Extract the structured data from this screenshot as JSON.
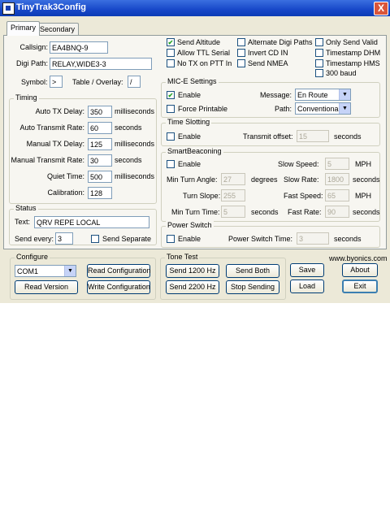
{
  "window": {
    "title": "TinyTrak3Config",
    "close": "X"
  },
  "tabs": [
    {
      "label": "Primary"
    },
    {
      "label": "Secondary"
    }
  ],
  "identity": {
    "callsign_label": "Callsign:",
    "callsign": "EA4BNQ-9",
    "digipath_label": "Digi Path:",
    "digipath": "RELAY,WIDE3-3",
    "symbol_label": "Symbol:",
    "symbol": ">",
    "table_label": "Table / Overlay:",
    "table": "/"
  },
  "options": {
    "send_altitude": "Send Altitude",
    "alt_digi": "Alternate Digi Paths",
    "only_valid": "Only Send Valid",
    "allow_ttl": "Allow TTL Serial",
    "invert_cd": "Invert CD IN",
    "ts_dhm": "Timestamp DHM",
    "no_tx_ptt": "No TX on PTT In",
    "send_nmea": "Send NMEA",
    "ts_hms": "Timestamp HMS",
    "baud300": "300 baud"
  },
  "timing": {
    "title": "Timing",
    "auto_tx_delay_label": "Auto TX Delay:",
    "auto_tx_delay": "350",
    "auto_tx_delay_unit": "milliseconds",
    "auto_rate_label": "Auto Transmit Rate:",
    "auto_rate": "60",
    "auto_rate_unit": "seconds",
    "man_tx_delay_label": "Manual TX Delay:",
    "man_tx_delay": "125",
    "man_tx_delay_unit": "milliseconds",
    "man_rate_label": "Manual Transmit Rate:",
    "man_rate": "30",
    "man_rate_unit": "seconds",
    "quiet_label": "Quiet Time:",
    "quiet": "500",
    "quiet_unit": "milliseconds",
    "cal_label": "Calibration:",
    "cal": "128"
  },
  "status": {
    "title": "Status",
    "text_label": "Text:",
    "text": "QRV REPE LOCAL",
    "every_label": "Send every:",
    "every": "3",
    "separate": "Send Separate"
  },
  "mice": {
    "title": "MIC-E Settings",
    "enable": "Enable",
    "message_label": "Message:",
    "message": "En Route",
    "force": "Force Printable",
    "path_label": "Path:",
    "path": "Conventional"
  },
  "timeslot": {
    "title": "Time Slotting",
    "enable": "Enable",
    "offset_label": "Transmit offset:",
    "offset": "15",
    "unit": "seconds"
  },
  "smart": {
    "title": "SmartBeaconing",
    "enable": "Enable",
    "slow_speed_label": "Slow Speed:",
    "slow_speed": "5",
    "slow_speed_unit": "MPH",
    "min_angle_label": "Min Turn Angle:",
    "min_angle": "27",
    "min_angle_unit": "degrees",
    "slow_rate_label": "Slow Rate:",
    "slow_rate": "1800",
    "slow_rate_unit": "seconds",
    "turn_slope_label": "Turn Slope:",
    "turn_slope": "255",
    "fast_speed_label": "Fast Speed:",
    "fast_speed": "65",
    "fast_speed_unit": "MPH",
    "min_time_label": "Min Turn Time:",
    "min_time": "5",
    "min_time_unit": "seconds",
    "fast_rate_label": "Fast Rate:",
    "fast_rate": "90",
    "fast_rate_unit": "seconds"
  },
  "power": {
    "title": "Power Switch",
    "enable": "Enable",
    "time_label": "Power Switch Time:",
    "time": "3",
    "unit": "seconds"
  },
  "configure": {
    "title": "Configure",
    "port": "COM1",
    "read_config": "Read Configuration",
    "read_version": "Read Version",
    "write_config": "Write Configuration"
  },
  "tone": {
    "title": "Tone Test",
    "send1200": "Send 1200 Hz",
    "send_both": "Send Both",
    "send2200": "Send 2200 Hz",
    "stop": "Stop Sending"
  },
  "actions": {
    "save": "Save",
    "about": "About",
    "load": "Load",
    "exit": "Exit",
    "url": "www.byonics.com"
  }
}
